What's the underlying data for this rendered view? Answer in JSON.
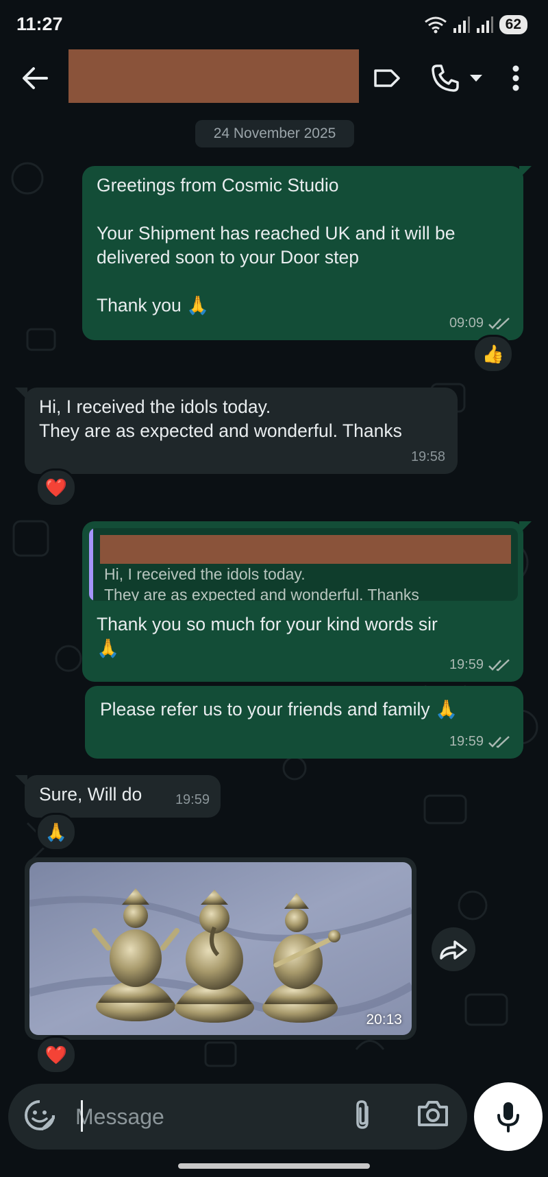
{
  "status_bar": {
    "time": "11:27",
    "battery": "62"
  },
  "chat": {
    "date_label": "24 November 2025",
    "messages": [
      {
        "text": "Greetings from Cosmic Studio\n\nYour Shipment has reached UK and it will be\ndelivered soon to your Door step\n\nThank you 🙏",
        "time": "09:09",
        "reaction": "👍"
      },
      {
        "text": "Hi, I received the idols today.\nThey are as expected and wonderful. Thanks",
        "time": "19:58",
        "reaction": "❤️"
      },
      {
        "quote": "Hi, I received the idols today.\nThey are as expected and wonderful. Thanks",
        "text": "Thank you so much for your kind words sir\n🙏",
        "time": "19:59"
      },
      {
        "text": "Please refer us to your friends and family 🙏",
        "time": "19:59"
      },
      {
        "text": "Sure, Will do",
        "time": "19:59",
        "reaction": "🙏"
      },
      {
        "time": "20:13",
        "reaction": "❤️"
      }
    ]
  },
  "composer": {
    "placeholder": "Message"
  },
  "colors": {
    "outgoing": "#134d37",
    "incoming": "#1f272a",
    "background": "#0b1014",
    "read_ticks": "#aab8b2"
  }
}
